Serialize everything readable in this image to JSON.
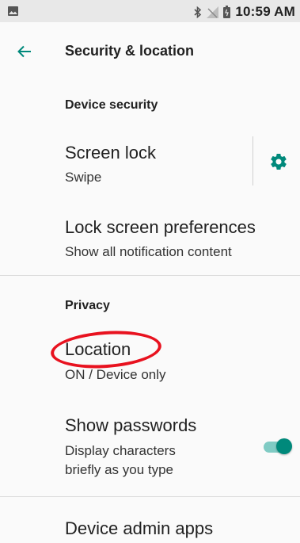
{
  "status_bar": {
    "time": "10:59 AM",
    "icons": [
      "image-notification-icon",
      "bluetooth-icon",
      "signal-off-icon",
      "battery-icon"
    ]
  },
  "app_bar": {
    "title": "Security & location",
    "back_icon": "back-arrow-icon"
  },
  "sections": {
    "device_security": {
      "header": "Device security",
      "screen_lock": {
        "title": "Screen lock",
        "summary": "Swipe",
        "settings_icon": "gear-icon"
      },
      "lock_screen_prefs": {
        "title": "Lock screen preferences",
        "summary": "Show all notification content"
      }
    },
    "privacy": {
      "header": "Privacy",
      "location": {
        "title": "Location",
        "summary": "ON / Device only"
      },
      "show_passwords": {
        "title": "Show passwords",
        "summary_line1": "Display characters",
        "summary_line2": "briefly as you type",
        "toggle_on": true
      }
    },
    "device_admin": {
      "title": "Device admin apps"
    }
  },
  "colors": {
    "accent": "#00897b",
    "accent_track": "#80cbc4",
    "annotation": "#e8121f"
  }
}
